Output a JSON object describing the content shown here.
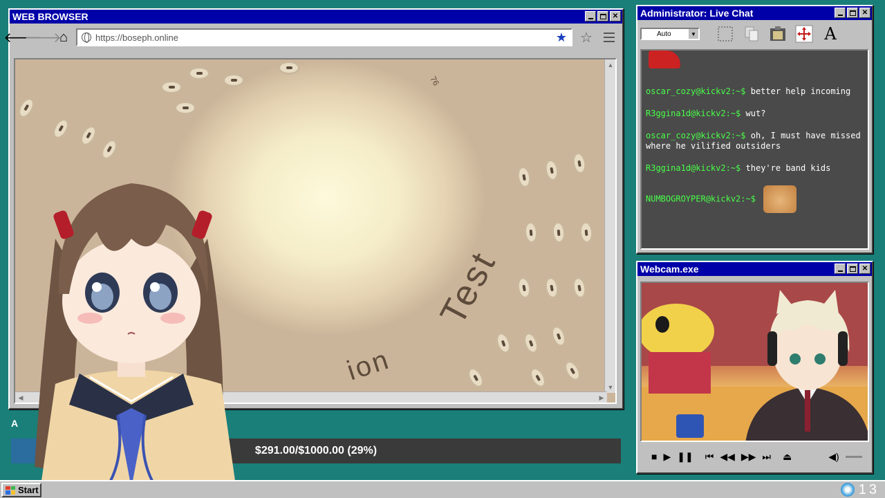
{
  "browser": {
    "title": "WEB BROWSER",
    "url": "https://boseph.online"
  },
  "content": {
    "test_text": "Test",
    "ion_text": "ion",
    "side_number": "76"
  },
  "donation": {
    "label": "$291.00/$1000.00 (29%)",
    "progress": 0.29,
    "side_letter": "A"
  },
  "chat": {
    "title": "Administrator: Live Chat",
    "font_size_select": "Auto",
    "messages": [
      {
        "user": "oscar_cozy@kickv2:~$",
        "text": "better help incoming"
      },
      {
        "user": "R3ggina1d@kickv2:~$",
        "text": "wut?"
      },
      {
        "user": "oscar_cozy@kickv2:~$",
        "text": "oh, I must have missed where he vilified outsiders"
      },
      {
        "user": "R3ggina1d@kickv2:~$",
        "text": "they're band kids"
      },
      {
        "user": "NUMBOGROYPER@kickv2:~$",
        "text": ""
      }
    ]
  },
  "webcam": {
    "title": "Webcam.exe"
  },
  "taskbar": {
    "start_label": "Start",
    "clock": "13"
  },
  "colors": {
    "desktop": "#1a7f79",
    "titlebar": "#0000a8",
    "chat_user": "#48ff48",
    "donation_fill": "#2a6d9e"
  }
}
